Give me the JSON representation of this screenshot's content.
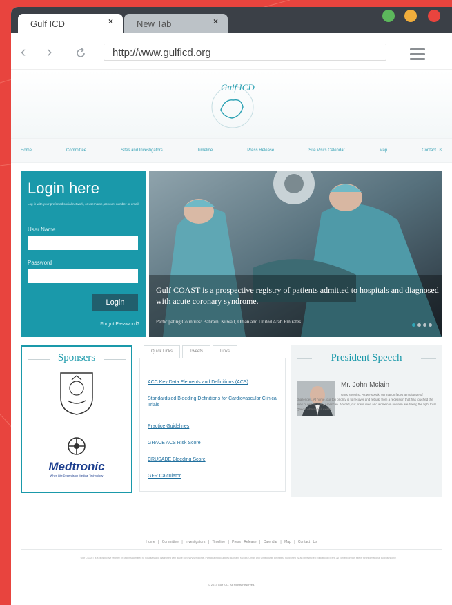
{
  "browser": {
    "tabs": [
      {
        "label": "Gulf ICD",
        "close": "×"
      },
      {
        "label": "New Tab",
        "close": "×"
      }
    ],
    "url": "http://www.gulficd.org",
    "window_dots": [
      "#5cb85c",
      "#f0ad3c",
      "#e8443e"
    ]
  },
  "site": {
    "logo_text": "Gulf ICD",
    "nav": [
      "Home",
      "Committee",
      "Sites and Investigators",
      "Timeline",
      "Press Release",
      "Site Visits Calendar",
      "Map",
      "Contact Us"
    ],
    "login": {
      "title": "Login here",
      "subtitle": "Log in with your preferred social network, or username, account number or email",
      "username_label": "User Name",
      "password_label": "Password",
      "button": "Login",
      "forgot": "Forgot Password?"
    },
    "slider": {
      "caption": "Gulf COAST is a prospective registry of patients admitted to hospitals and diagnosed with acute coronary syndrome.",
      "subcaption": "Participating Countries: Bahrain, Kuwait, Oman and United Arab Emirates"
    },
    "sponsors": {
      "title": "Sponsers",
      "medtronic": "Medtronic",
      "medtronic_tagline": "When Life Depends on Medical Technology"
    },
    "quick_links": {
      "tabs": [
        "Quick Links",
        "Tweets",
        "Links"
      ],
      "items": [
        "ACC Key Data Elements and Definitions (ACS)",
        "Standardized Bleeding Definitions for Cardiovascular Clinical Trials",
        "Practice Guidelines",
        "GRACE ACS Risk Score",
        "CRUSADE Bleeding Score",
        "GFR Calculator"
      ]
    },
    "president": {
      "title": "President Speech",
      "name": "Mr. John Mclain",
      "speech": "Good evening. As we speak, our nation faces a multitude of challenges. At home, our top priority is to recover and rebuild from a recession that has touched the lives of nearly every American. Abroad, our brave men and women in uniform are taking the fight to al Qaeda wherever it exists."
    },
    "footer": {
      "nav": "Home | Committee | Investigators | Timeline | Press Release | Calendar | Map | Contact Us",
      "text": "Gulf COAST is a prospective registry of patients admitted to hospitals and diagnosed with acute coronary syndrome. Participating countries: Bahrain, Kuwait, Oman and United Arab Emirates. Supported by an unrestricted educational grant. All content on this site is for informational purposes only.",
      "copyright": "© 2013 Gulf ICD. All Rights Reserved."
    }
  }
}
